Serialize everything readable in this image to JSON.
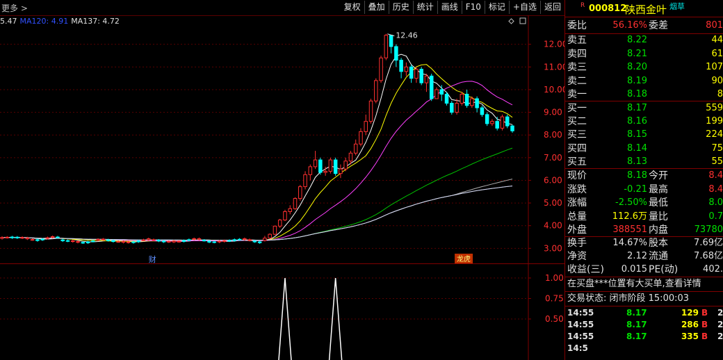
{
  "toolbar": {
    "crumb": "更多 >",
    "buttons": [
      "复权",
      "叠加",
      "历史",
      "统计",
      "画线",
      "F10",
      "标记",
      "+自选",
      "返回"
    ]
  },
  "ma_legend": [
    {
      "text": "5.47",
      "color": "#e0e0e0"
    },
    {
      "text": "MA120: 4.91",
      "color": "#3050ff"
    },
    {
      "text": "MA137: 4.72",
      "color": "#e0e0e0"
    }
  ],
  "chart_data": [
    {
      "type": "candlestick",
      "title": "",
      "ylim": [
        2.55,
        12.85
      ],
      "yticks": [
        "12.00",
        "11.00",
        "10.00",
        "9.00",
        "8.00",
        "7.00",
        "6.00",
        "5.00",
        "4.00",
        "3.00"
      ],
      "ytick_values": [
        12,
        11,
        10,
        9,
        8,
        7,
        6,
        5,
        4,
        3
      ],
      "annotations": [
        {
          "text": "12.46",
          "value": 12.46
        }
      ],
      "markers": [
        "财",
        "龙虎"
      ],
      "rally": [
        [
          3.35,
          3.45,
          3.55,
          3.3
        ],
        [
          3.45,
          3.62,
          3.66,
          3.4
        ],
        [
          3.62,
          3.98,
          4.0,
          3.58
        ],
        [
          3.98,
          4.25,
          4.3,
          3.9
        ],
        [
          4.25,
          4.62,
          4.7,
          4.2
        ],
        [
          4.62,
          4.75,
          4.9,
          4.5
        ],
        [
          4.75,
          5.2,
          5.25,
          4.7
        ],
        [
          5.2,
          5.72,
          5.8,
          5.1
        ],
        [
          5.72,
          6.25,
          6.4,
          5.6
        ],
        [
          6.25,
          6.6,
          6.7,
          6.0
        ],
        [
          6.6,
          6.9,
          7.3,
          6.5
        ],
        [
          6.9,
          6.35,
          7.0,
          6.25
        ],
        [
          6.35,
          6.4,
          6.6,
          6.2
        ],
        [
          6.4,
          6.9,
          7.0,
          6.3
        ],
        [
          6.9,
          6.3,
          7.0,
          6.2
        ],
        [
          6.3,
          6.5,
          6.7,
          6.1
        ],
        [
          6.5,
          6.85,
          7.0,
          6.4
        ],
        [
          6.85,
          7.2,
          7.3,
          6.7
        ],
        [
          7.2,
          7.6,
          7.8,
          7.1
        ],
        [
          7.6,
          8.15,
          8.3,
          7.5
        ],
        [
          8.15,
          8.6,
          8.9,
          8.0
        ],
        [
          8.6,
          9.5,
          9.6,
          8.5
        ],
        [
          9.5,
          10.4,
          10.5,
          9.4
        ],
        [
          10.4,
          11.4,
          11.5,
          10.3
        ],
        [
          11.4,
          12.4,
          12.46,
          11.3
        ],
        [
          12.4,
          11.9,
          12.4,
          11.6
        ],
        [
          11.9,
          11.3,
          12.0,
          11.0
        ],
        [
          11.3,
          10.8,
          11.4,
          10.5
        ],
        [
          10.8,
          11.0,
          11.2,
          10.6
        ],
        [
          11.0,
          10.5,
          11.1,
          10.3
        ],
        [
          10.5,
          10.9,
          11.0,
          10.3
        ],
        [
          10.9,
          10.3,
          11.0,
          10.2
        ],
        [
          10.3,
          10.6,
          10.7,
          9.9
        ],
        [
          10.6,
          9.6,
          10.7,
          9.5
        ],
        [
          9.6,
          10.0,
          10.1,
          9.6
        ],
        [
          10.0,
          9.8,
          10.2,
          9.5
        ],
        [
          9.8,
          9.4,
          9.9,
          9.3
        ],
        [
          9.4,
          9.0,
          9.5,
          8.9
        ],
        [
          9.0,
          9.4,
          9.6,
          8.9
        ],
        [
          9.4,
          9.8,
          9.9,
          9.3
        ],
        [
          9.8,
          9.3,
          10.0,
          9.2
        ],
        [
          9.3,
          9.6,
          9.7,
          9.2
        ],
        [
          9.6,
          9.2,
          9.7,
          9.0
        ],
        [
          9.2,
          8.9,
          9.3,
          8.8
        ],
        [
          8.9,
          8.5,
          9.0,
          8.4
        ],
        [
          8.5,
          8.6,
          8.7,
          8.4
        ],
        [
          8.6,
          8.3,
          8.8,
          8.2
        ],
        [
          8.3,
          8.8,
          8.9,
          8.2
        ],
        [
          8.8,
          8.4,
          8.9,
          8.3
        ],
        [
          8.4,
          8.18,
          8.45,
          8.1
        ]
      ]
    },
    {
      "type": "line",
      "title": "",
      "ylim": [
        0,
        1
      ],
      "yticks": [
        "1.00",
        "0.75",
        "0.50"
      ],
      "ytick_values": [
        1.0,
        0.75,
        0.5
      ],
      "peaks": [
        {
          "x_index": 0
        },
        {
          "x_index": 1
        }
      ]
    }
  ],
  "panel": {
    "r_mark": "R",
    "code": "000812",
    "name": "陕西金叶",
    "tag": "烟草",
    "weibi_label": "委比",
    "weibi_value": "56.16%",
    "weicha_label": "委差",
    "weicha_value": "801",
    "asks": [
      {
        "label": "卖五",
        "price": "8.22",
        "vol": "44"
      },
      {
        "label": "卖四",
        "price": "8.21",
        "vol": "61"
      },
      {
        "label": "卖三",
        "price": "8.20",
        "vol": "107"
      },
      {
        "label": "卖二",
        "price": "8.19",
        "vol": "90"
      },
      {
        "label": "卖一",
        "price": "8.18",
        "vol": "8"
      }
    ],
    "bids": [
      {
        "label": "买一",
        "price": "8.17",
        "vol": "559"
      },
      {
        "label": "买二",
        "price": "8.16",
        "vol": "199"
      },
      {
        "label": "买三",
        "price": "8.15",
        "vol": "224"
      },
      {
        "label": "买四",
        "price": "8.14",
        "vol": "75"
      },
      {
        "label": "买五",
        "price": "8.13",
        "vol": "55"
      }
    ],
    "quote": [
      {
        "l1": "现价",
        "v1": "8.18",
        "c1": "green",
        "l2": "今开",
        "v2": "8.4",
        "c2": "red"
      },
      {
        "l1": "涨跌",
        "v1": "-0.21",
        "c1": "green",
        "l2": "最高",
        "v2": "8.4",
        "c2": "red"
      },
      {
        "l1": "涨幅",
        "v1": "-2.50%",
        "c1": "green",
        "l2": "最低",
        "v2": "8.0",
        "c2": "green"
      },
      {
        "l1": "总量",
        "v1": "112.6万",
        "c1": "yellow",
        "l2": "量比",
        "v2": "0.7",
        "c2": "green"
      },
      {
        "l1": "外盘",
        "v1": "388551",
        "c1": "red",
        "l2": "内盘",
        "v2": "73780",
        "c2": "green"
      }
    ],
    "fin": [
      {
        "l1": "换手",
        "v1": "14.67%",
        "l2": "股本",
        "v2": "7.69亿"
      },
      {
        "l1": "净资",
        "v1": "2.12",
        "l2": "流通",
        "v2": "7.68亿"
      },
      {
        "l1": "收益(三)",
        "v1": "0.015",
        "l2": "PE(动)",
        "v2": "402."
      }
    ],
    "notice": "在买盘***位置有大买单,查看详情",
    "status": "交易状态: 闭市阶段 15:00:03",
    "ticks": [
      {
        "time": "14:55",
        "price": "8.17",
        "vol": "129",
        "dir": "B",
        "num": "2"
      },
      {
        "time": "14:55",
        "price": "8.17",
        "vol": "286",
        "dir": "B",
        "num": "2"
      },
      {
        "time": "14:55",
        "price": "8.17",
        "vol": "335",
        "dir": "B",
        "num": "2"
      },
      {
        "time": "14:5",
        "price": "",
        "vol": "",
        "dir": "",
        "num": ""
      }
    ]
  }
}
